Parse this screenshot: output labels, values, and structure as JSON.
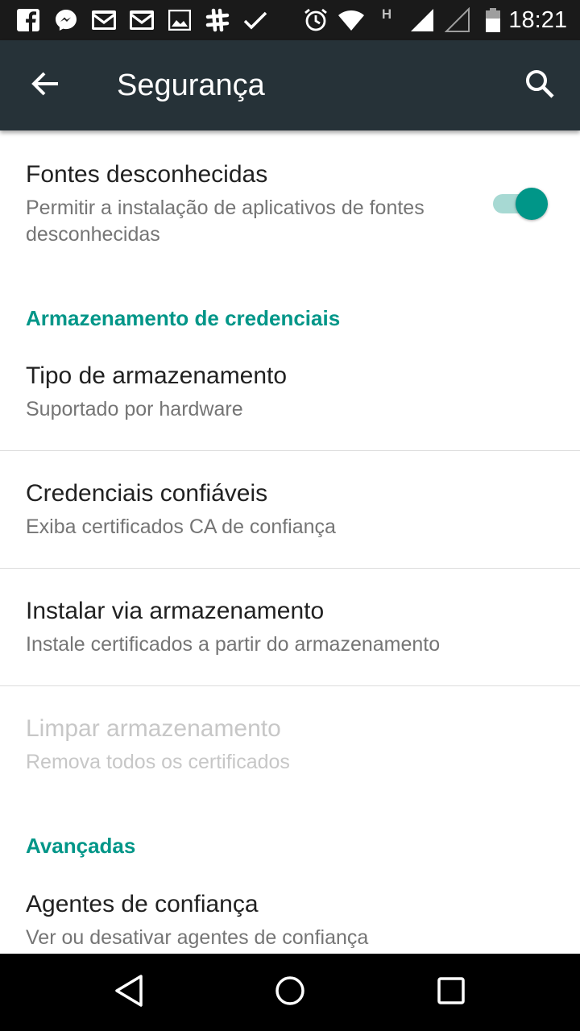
{
  "status_bar": {
    "time": "18:21",
    "icons_left": [
      "facebook-icon",
      "messenger-icon",
      "gmail-icon",
      "gmail-icon",
      "gallery-icon",
      "slack-icon",
      "check-icon"
    ],
    "icons_right": [
      "alarm-icon",
      "wifi-icon",
      "h-network-icon",
      "signal-full-icon",
      "signal-empty-icon",
      "battery-icon"
    ],
    "network_letter": "H"
  },
  "app_bar": {
    "title": "Segurança",
    "back_icon": "arrow-back-icon",
    "search_icon": "search-icon",
    "background": "#263238"
  },
  "preferences": {
    "unknown_sources": {
      "title": "Fontes desconhecidas",
      "summary": "Permitir a instalação de aplicativos de fontes desconhecidas",
      "enabled": true
    },
    "credential_storage_header": "Armazenamento de credenciais",
    "storage_type": {
      "title": "Tipo de armazenamento",
      "summary": "Suportado por hardware"
    },
    "trusted_credentials": {
      "title": "Credenciais confiáveis",
      "summary": "Exiba certificados CA de confiança"
    },
    "install_from_storage": {
      "title": "Instalar via armazenamento",
      "summary": "Instale certificados a partir do armazenamento"
    },
    "clear_credentials": {
      "title": "Limpar armazenamento",
      "summary": "Remova todos os certificados",
      "disabled": true
    },
    "advanced_header": "Avançadas",
    "trust_agents": {
      "title": "Agentes de confiança",
      "summary": "Ver ou desativar agentes de confiança"
    }
  },
  "nav_bar": {
    "back": "nav-back-icon",
    "home": "nav-home-icon",
    "recents": "nav-recents-icon"
  },
  "colors": {
    "accent": "#009688",
    "accent_track": "#a7d9d3",
    "status_bar": "#1a1a1a",
    "nav_bar": "#000000"
  }
}
